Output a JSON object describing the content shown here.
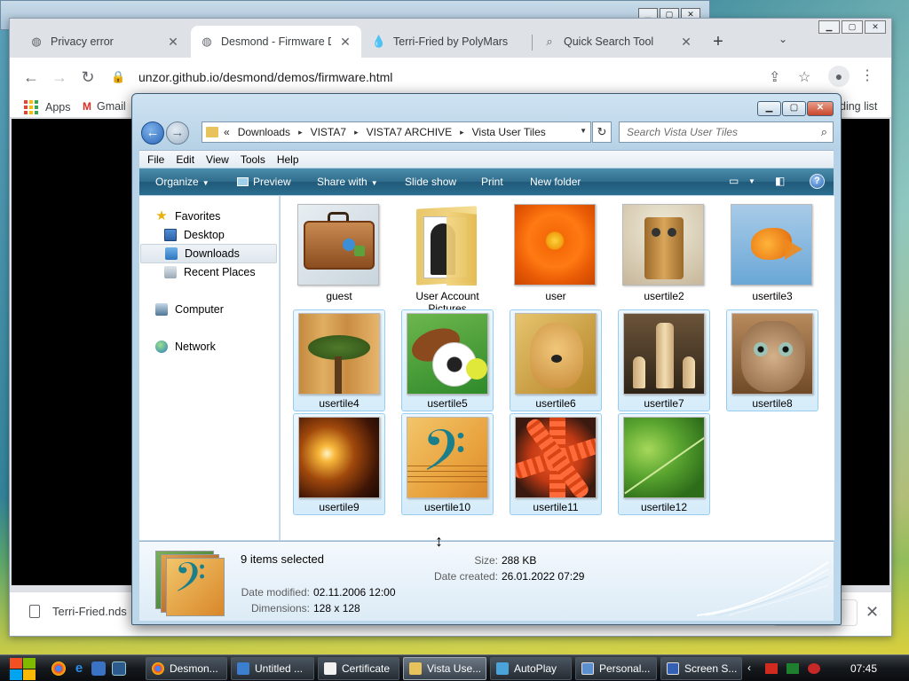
{
  "chrome": {
    "tabs": [
      {
        "title": "Privacy error",
        "icon": "globe-icon",
        "active": false
      },
      {
        "title": "Desmond - Firmware D",
        "icon": "globe-icon",
        "active": true
      },
      {
        "title": "Terri-Fried by PolyMars",
        "icon": "drop-icon",
        "active": false
      },
      {
        "title": "Quick Search Tool",
        "icon": "search-icon",
        "active": false
      }
    ],
    "new_tab": "+",
    "tab_search": "⌄",
    "url": "unzor.github.io/desmond/demos/firmware.html",
    "bookmarks": [
      {
        "label": "Apps",
        "icon": "apps-icon"
      },
      {
        "label": "Gmail",
        "icon": "gmail-icon"
      },
      {
        "label": "ding list",
        "icon": "reading-list-icon"
      }
    ],
    "download": {
      "filename": "Terri-Fried.nds"
    }
  },
  "explorer": {
    "breadcrumb": [
      "«",
      "Downloads",
      "VISTA7",
      "VISTA7 ARCHIVE",
      "Vista User Tiles"
    ],
    "search_placeholder": "Search Vista User Tiles",
    "menu": [
      "File",
      "Edit",
      "View",
      "Tools",
      "Help"
    ],
    "commands": {
      "organize": "Organize",
      "preview": "Preview",
      "share_with": "Share with",
      "slide_show": "Slide show",
      "print": "Print",
      "new_folder": "New folder"
    },
    "nav": {
      "favorites": "Favorites",
      "desktop": "Desktop",
      "downloads": "Downloads",
      "recent_places": "Recent Places",
      "computer": "Computer",
      "network": "Network"
    },
    "files": [
      {
        "name": "guest",
        "selected": false
      },
      {
        "name": "User Account Pictures",
        "selected": false
      },
      {
        "name": "user",
        "selected": false
      },
      {
        "name": "usertile2",
        "selected": false
      },
      {
        "name": "usertile3",
        "selected": false
      },
      {
        "name": "usertile4",
        "selected": true
      },
      {
        "name": "usertile5",
        "selected": true
      },
      {
        "name": "usertile6",
        "selected": true
      },
      {
        "name": "usertile7",
        "selected": true
      },
      {
        "name": "usertile8",
        "selected": true
      },
      {
        "name": "usertile9",
        "selected": true
      },
      {
        "name": "usertile10",
        "selected": true
      },
      {
        "name": "usertile11",
        "selected": true
      },
      {
        "name": "usertile12",
        "selected": true
      }
    ],
    "details": {
      "count": "9 items selected",
      "date_modified_label": "Date modified:",
      "date_modified": "02.11.2006 12:00",
      "dimensions_label": "Dimensions:",
      "dimensions": "128 x 128",
      "size_label": "Size:",
      "size": "288 KB",
      "date_created_label": "Date created:",
      "date_created": "26.01.2022 07:29"
    }
  },
  "taskbar": {
    "tasks": [
      {
        "label": "Desmon...",
        "icon": "chrome-icon",
        "active": false
      },
      {
        "label": "Untitled ...",
        "icon": "paint-icon",
        "active": false
      },
      {
        "label": "Certificate",
        "icon": "certificate-icon",
        "active": false
      },
      {
        "label": "Vista Use...",
        "icon": "folder-icon",
        "active": true
      },
      {
        "label": "AutoPlay",
        "icon": "autoplay-icon",
        "active": false
      },
      {
        "label": "Personal...",
        "icon": "personalize-icon",
        "active": false
      },
      {
        "label": "Screen S...",
        "icon": "screensaver-icon",
        "active": false
      }
    ],
    "clock": "07:45"
  },
  "colors": {
    "command_bar": "#2f6c8c",
    "selection_fill": "#d6ecfa",
    "selection_border": "#99cdef",
    "back_button": "#2a66b8",
    "close_button": "#c9452a"
  }
}
